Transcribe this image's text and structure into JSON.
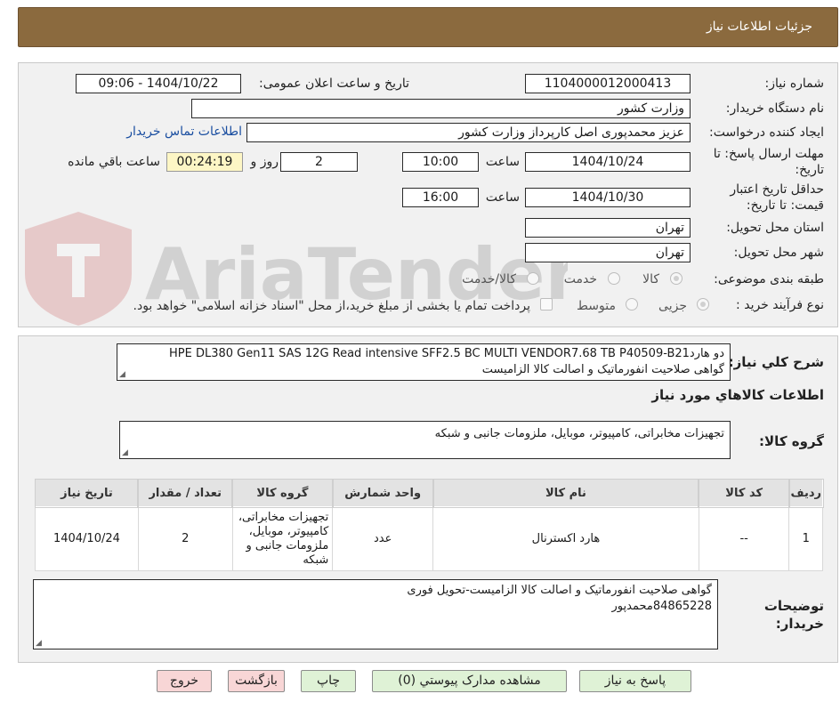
{
  "header": {
    "title": "جزئیات اطلاعات نیاز"
  },
  "watermark": {
    "text": "AriaTender.neT"
  },
  "form": {
    "need_number_label": "شماره نیاز:",
    "need_number": "1104000012000413",
    "announce_label": "تاریخ و ساعت اعلان عمومی:",
    "announce_value": "1404/10/22 - 09:06",
    "buyer_org_label": "نام دستگاه خریدار:",
    "buyer_org": "وزارت کشور",
    "requester_label": "ایجاد کننده درخواست:",
    "requester": "عزیز محمدپوری اصل کارپرداز وزارت کشور",
    "contact_link": "اطلاعات تماس خریدار",
    "deadline_label_1": "مهلت ارسال پاسخ: تا",
    "deadline_label_2": "تاریخ:",
    "deadline_date": "1404/10/24",
    "time_label": "ساعت",
    "deadline_time": "10:00",
    "days_value": "2",
    "days_label": "روز و",
    "remaining_time": "00:24:19",
    "remaining_label": "ساعت باقي مانده",
    "validity_label_1": "حداقل تاریخ اعتبار",
    "validity_label_2": "قیمت: تا تاریخ:",
    "validity_date": "1404/10/30",
    "validity_time": "16:00",
    "province_label": "استان محل تحویل:",
    "province": "تهران",
    "city_label": "شهر محل تحویل:",
    "city": "تهران",
    "category_label": "طبقه بندی موضوعی:",
    "category_options": [
      "کالا",
      "خدمت",
      "کالا/خدمت"
    ],
    "process_label": "نوع فرآیند خرید :",
    "process_options": [
      "جزیی",
      "متوسط"
    ],
    "payment_note": "پرداخت تمام یا بخشی از مبلغ خرید،از محل \"اسناد خزانه اسلامی\" خواهد بود."
  },
  "summary": {
    "label": "شرح کلي نياز:",
    "line1": "دو هاردHPE DL380 Gen11 SAS 12G Read intensive SFF2.5 BC MULTI VENDOR7.68 TB P40509-B21",
    "line2": "گواهی صلاحیت انفورماتیک و اصالت کالا الزامیست"
  },
  "goods": {
    "section_title": "اطلاعات كالاهاي مورد نياز",
    "group_label": "گروه کالا:",
    "group_value": "تجهیزات مخابراتی، کامپیوتر، موبایل، ملزومات جانبی و شبکه"
  },
  "table": {
    "headers": [
      "ردیف",
      "کد کالا",
      "نام کالا",
      "واحد شمارش",
      "گروه کالا",
      "تعداد / مقدار",
      "تاریخ نیاز"
    ],
    "row": {
      "index": "1",
      "code": "--",
      "name": "هارد اکسترنال",
      "unit": "عدد",
      "group_line1": "تجهیزات مخابراتی،",
      "group_line2": "کامپیوتر، موبایل،",
      "group_line3": "ملزومات جانبی و",
      "group_line4": "شبکه",
      "quantity": "2",
      "date": "1404/10/24"
    }
  },
  "notes": {
    "label_1": "توضیحات",
    "label_2": "خریدار:",
    "line1": "گواهی صلاحیت انفورماتیک و اصالت کالا الزامیست-تحویل فوری",
    "line2": "84865228محمدپور"
  },
  "buttons": {
    "reply": "پاسخ به نیاز",
    "attachments": "مشاهده مدارک پیوستي (0)",
    "print": "چاپ",
    "back": "بازگشت",
    "exit": "خروج"
  },
  "colors": {
    "header_bg": "#8b6a3e",
    "panel_bg": "#f1f1f1",
    "link": "#1a4ea0",
    "timer_bg": "#fdf6c5",
    "button_green": "#dff2d6",
    "button_red": "#f8d6d6"
  }
}
